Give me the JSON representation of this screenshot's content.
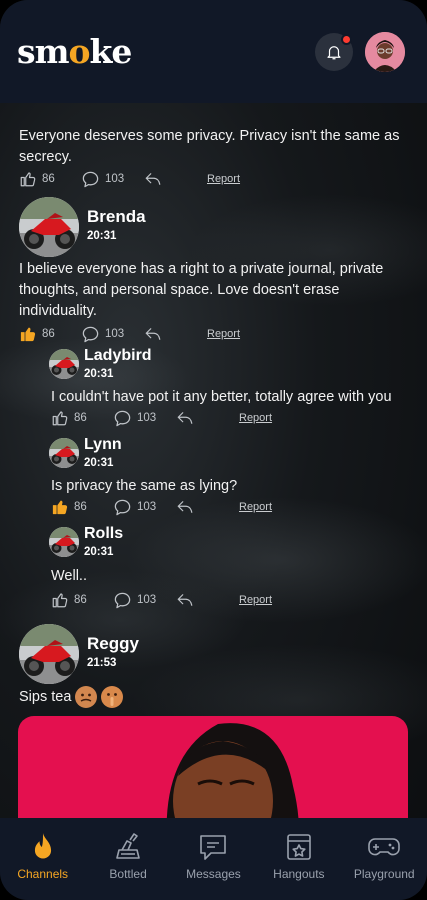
{
  "app": {
    "logo_pre": "sm",
    "logo_o": "o",
    "logo_post": "ke"
  },
  "colors": {
    "accent": "#f5a623",
    "header_bg": "#111827",
    "nav_bg": "#111827",
    "badge": "#ff3b30",
    "card": "#e4104f"
  },
  "header": {
    "bell_icon": "bell-icon",
    "has_notification": true
  },
  "posts": [
    {
      "text": "Everyone deserves some privacy. Privacy isn't the same as secrecy.",
      "likes": "86",
      "comments": "103",
      "report": "Report",
      "liked": false
    },
    {
      "user": "Brenda",
      "time": "20:31",
      "text": "I believe everyone has a right to a private journal, private thoughts, and personal space. Love doesn't erase individuality.",
      "likes": "86",
      "comments": "103",
      "report": "Report",
      "liked": true,
      "replies": [
        {
          "user": "Ladybird",
          "time": "20:31",
          "text": "I couldn't have pot it any better, totally agree with you",
          "likes": "86",
          "comments": "103",
          "report": "Report",
          "liked": false
        },
        {
          "user": "Lynn",
          "time": "20:31",
          "text": "Is privacy the same as lying?",
          "likes": "86",
          "comments": "103",
          "report": "Report",
          "liked": true
        },
        {
          "user": "Rolls",
          "time": "20:31",
          "text": "Well..",
          "likes": "86",
          "comments": "103",
          "report": "Report",
          "liked": false
        }
      ]
    },
    {
      "user": "Reggy",
      "time": "21:53",
      "text": "Sips tea",
      "emojis": [
        "nauseated-face-emoji",
        "shushing-face-emoji"
      ]
    }
  ],
  "nav": [
    {
      "label": "Channels",
      "icon": "flame-icon",
      "active": true
    },
    {
      "label": "Bottled",
      "icon": "bottle-icon",
      "active": false
    },
    {
      "label": "Messages",
      "icon": "message-icon",
      "active": false
    },
    {
      "label": "Hangouts",
      "icon": "hangouts-icon",
      "active": false
    },
    {
      "label": "Playground",
      "icon": "gamepad-icon",
      "active": false
    }
  ]
}
